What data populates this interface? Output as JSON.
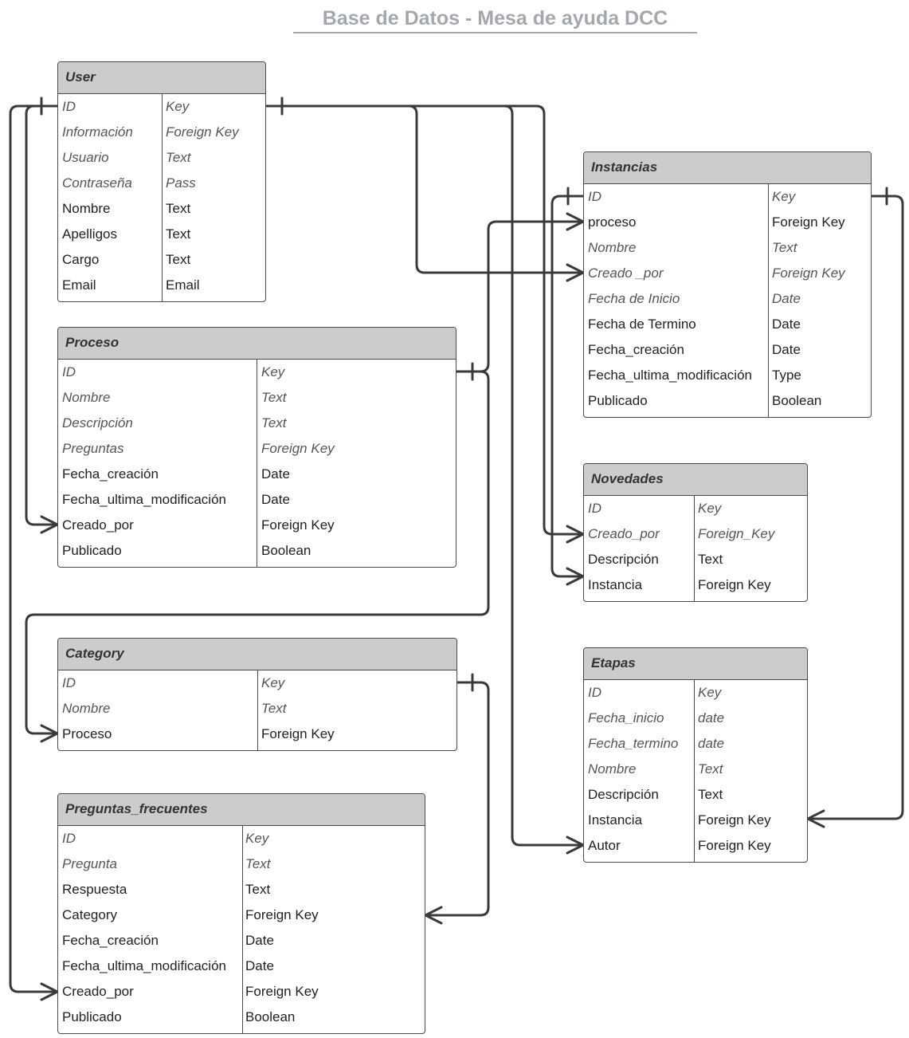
{
  "title": "Base de Datos  - Mesa de ayuda DCC",
  "tables": [
    {
      "name": "User",
      "rows": [
        {
          "f": "ID",
          "t": "Key",
          "i": true
        },
        {
          "f": "Información",
          "t": "Foreign Key",
          "i": true
        },
        {
          "f": "Usuario",
          "t": "Text",
          "i": true
        },
        {
          "f": "Contraseña",
          "t": "Pass",
          "i": true
        },
        {
          "f": "Nombre",
          "t": "Text",
          "i": false
        },
        {
          "f": "Apelligos",
          "t": "Text",
          "i": false
        },
        {
          "f": "Cargo",
          "t": "Text",
          "i": false
        },
        {
          "f": "Email",
          "t": "Email",
          "i": false
        }
      ]
    },
    {
      "name": "Proceso",
      "rows": [
        {
          "f": "ID",
          "t": "Key",
          "i": true
        },
        {
          "f": "Nombre",
          "t": "Text",
          "i": true
        },
        {
          "f": "Descripción",
          "t": "Text",
          "i": true
        },
        {
          "f": "Preguntas",
          "t": "Foreign Key",
          "i": true
        },
        {
          "f": "Fecha_creación",
          "t": "Date",
          "i": false
        },
        {
          "f": "Fecha_ultima_modificación",
          "t": "Date",
          "i": false
        },
        {
          "f": "Creado_por",
          "t": "Foreign Key",
          "i": false
        },
        {
          "f": "Publicado",
          "t": "Boolean",
          "i": false
        }
      ]
    },
    {
      "name": "Category",
      "rows": [
        {
          "f": "ID",
          "t": "Key",
          "i": true
        },
        {
          "f": "Nombre",
          "t": "Text",
          "i": true
        },
        {
          "f": "Proceso",
          "t": "Foreign Key",
          "i": false
        }
      ]
    },
    {
      "name": "Preguntas_frecuentes",
      "rows": [
        {
          "f": "ID",
          "t": "Key",
          "i": true
        },
        {
          "f": "Pregunta",
          "t": "Text",
          "i": true
        },
        {
          "f": "Respuesta",
          "t": "Text",
          "i": false
        },
        {
          "f": "Category",
          "t": "Foreign Key",
          "i": false
        },
        {
          "f": "Fecha_creación",
          "t": "Date",
          "i": false
        },
        {
          "f": "Fecha_ultima_modificación",
          "t": "Date",
          "i": false
        },
        {
          "f": "Creado_por",
          "t": "Foreign Key",
          "i": false
        },
        {
          "f": "Publicado",
          "t": "Boolean",
          "i": false
        }
      ]
    },
    {
      "name": "Instancias",
      "rows": [
        {
          "f": "ID",
          "t": "Key",
          "i": true
        },
        {
          "f": "proceso",
          "t": "Foreign Key",
          "i": false
        },
        {
          "f": "Nombre",
          "t": "Text",
          "i": true
        },
        {
          "f": "Creado _por",
          "t": "Foreign Key",
          "i": true
        },
        {
          "f": "Fecha de Inicio",
          "t": "Date",
          "i": true
        },
        {
          "f": "Fecha de Termino",
          "t": "Date",
          "i": false
        },
        {
          "f": "Fecha_creación",
          "t": "Date",
          "i": false
        },
        {
          "f": "Fecha_ultima_modificación",
          "t": "Type",
          "i": false
        },
        {
          "f": "Publicado",
          "t": "Boolean",
          "i": false
        }
      ]
    },
    {
      "name": "Novedades",
      "rows": [
        {
          "f": "ID",
          "t": "Key",
          "i": true
        },
        {
          "f": "Creado_por",
          "t": "Foreign_Key",
          "i": true
        },
        {
          "f": "Descripción",
          "t": "Text",
          "i": false
        },
        {
          "f": "Instancia",
          "t": "Foreign Key",
          "i": false
        }
      ]
    },
    {
      "name": "Etapas",
      "rows": [
        {
          "f": "ID",
          "t": "Key",
          "i": true
        },
        {
          "f": "Fecha_inicio",
          "t": "date",
          "i": true
        },
        {
          "f": "Fecha_termino",
          "t": "date",
          "i": true
        },
        {
          "f": "Nombre",
          "t": "Text",
          "i": true
        },
        {
          "f": "Descripción",
          "t": "Text",
          "i": false
        },
        {
          "f": "Instancia",
          "t": "Foreign Key",
          "i": false
        },
        {
          "f": "Autor",
          "t": "Foreign Key",
          "i": false
        }
      ]
    }
  ]
}
